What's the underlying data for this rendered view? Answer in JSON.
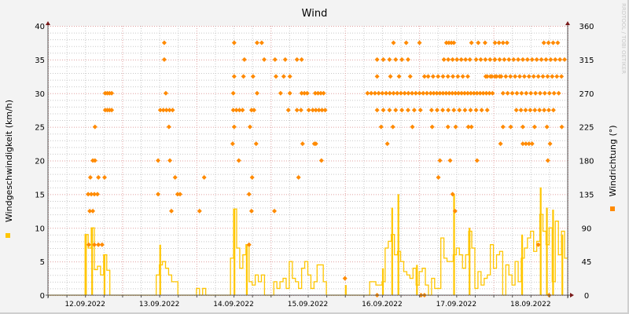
{
  "chart_data": {
    "type": "line",
    "title": "Wind",
    "ylabel": "Windgeschwindigkeit (km/h)",
    "y2label": "Windrichtung (°)",
    "watermark": "RRDTOOL / TOBI OETIKER",
    "ylim": [
      0,
      40
    ],
    "y2lim": [
      0,
      360
    ],
    "yticks": [
      "0",
      "5",
      "10",
      "15",
      "20",
      "25",
      "30",
      "35",
      "40"
    ],
    "y2ticks": [
      "0",
      "45",
      "90",
      "135",
      "180",
      "225",
      "270",
      "315",
      "360"
    ],
    "x_unit": "hours since 12.09.2022 00:00",
    "xlim": [
      0,
      168
    ],
    "xticks": [
      "12.09.2022",
      "13.09.2022",
      "14.09.2022",
      "15.09.2022",
      "16.09.2022",
      "17.09.2022",
      "18.09.2022"
    ],
    "grid": true,
    "colors": {
      "speed": "#ffc600",
      "direction": "#ff8a00",
      "axis": "#7a1a1a",
      "major_grid": "#e0a0a0",
      "minor_grid": "#c8c8c8"
    },
    "speed_hourly": [
      0,
      0,
      0,
      0,
      0,
      0,
      0,
      0,
      0,
      0,
      0,
      0,
      9,
      7,
      10,
      3.8,
      4.3,
      3,
      6,
      3.7,
      0,
      0,
      0,
      0,
      0,
      0,
      0,
      0,
      0,
      0,
      0,
      0,
      0,
      0,
      0,
      3,
      4.5,
      5,
      4,
      3,
      2,
      2,
      0,
      0,
      0,
      0,
      0,
      0,
      1,
      0,
      1,
      0,
      0,
      0,
      0,
      0,
      0,
      0,
      0,
      5.5,
      12.8,
      7,
      4,
      6,
      7.5,
      2,
      1.5,
      3,
      2,
      3,
      0,
      0,
      0,
      2,
      1,
      2,
      2.5,
      1,
      5,
      2.5,
      2,
      1,
      4,
      5,
      3,
      1,
      2,
      4.5,
      4.5,
      2,
      0,
      0,
      0,
      0,
      0,
      0,
      0,
      0,
      0,
      0,
      0,
      0,
      0,
      0,
      2,
      2,
      1.5,
      1.5,
      2,
      7,
      8,
      9,
      6,
      6.5,
      5,
      3.5,
      3,
      2.5,
      4,
      1.5,
      3.5,
      4,
      1.5,
      0,
      2.5,
      1,
      1,
      8.5,
      5.5,
      5,
      5,
      6,
      7,
      6,
      4,
      6,
      9.5,
      7,
      1,
      3.5,
      1.5,
      2.5,
      3,
      7.5,
      4,
      6,
      6.5,
      0,
      4.5,
      3,
      1.5,
      5,
      2,
      5.5,
      7,
      8.5,
      9.5,
      6.5,
      8,
      12,
      9.5,
      7.5,
      10,
      2,
      11,
      6,
      9.5,
      5.5
    ],
    "speed_peaks": [
      [
        12,
        9
      ],
      [
        14,
        10
      ],
      [
        18,
        6
      ],
      [
        36,
        7.5
      ],
      [
        60,
        12.8
      ],
      [
        64,
        7.5
      ],
      [
        96,
        1.5
      ],
      [
        108,
        4
      ],
      [
        111,
        13
      ],
      [
        113,
        15
      ],
      [
        119,
        4.5
      ],
      [
        131,
        15
      ],
      [
        136,
        10
      ],
      [
        153,
        9
      ],
      [
        159,
        16
      ],
      [
        161,
        13
      ],
      [
        163,
        12.7
      ],
      [
        166,
        9
      ]
    ],
    "direction_points": [
      [
        15.2,
        225
      ],
      [
        14.5,
        180
      ],
      [
        15.2,
        180
      ],
      [
        13.7,
        157.5
      ],
      [
        16.3,
        157.5
      ],
      [
        18.3,
        157.5
      ],
      [
        13.5,
        112.5
      ],
      [
        14.5,
        112.5
      ],
      [
        13.2,
        67.5
      ],
      [
        15,
        67.5
      ],
      [
        16.3,
        67.5
      ],
      [
        17.5,
        67.5
      ],
      [
        37.6,
        337.5
      ],
      [
        37.6,
        315
      ],
      [
        38.1,
        270
      ],
      [
        39.1,
        225
      ],
      [
        35.6,
        180
      ],
      [
        39.4,
        180
      ],
      [
        41.1,
        157.5
      ],
      [
        35.6,
        135
      ],
      [
        41.9,
        135
      ],
      [
        42.7,
        135
      ],
      [
        39.9,
        112.5
      ],
      [
        50.5,
        157.5
      ],
      [
        49,
        112.5
      ],
      [
        60.2,
        337.5
      ],
      [
        67.6,
        337.5
      ],
      [
        69.1,
        337.5
      ],
      [
        63.5,
        315
      ],
      [
        69.9,
        315
      ],
      [
        60.2,
        292.5
      ],
      [
        63.2,
        292.5
      ],
      [
        66.3,
        292.5
      ],
      [
        59.9,
        270
      ],
      [
        67.6,
        270
      ],
      [
        60.2,
        225
      ],
      [
        65.3,
        225
      ],
      [
        59.7,
        202.5
      ],
      [
        67.3,
        202.5
      ],
      [
        61.7,
        180
      ],
      [
        66,
        157.5
      ],
      [
        65,
        135
      ],
      [
        65.8,
        112.5
      ],
      [
        65,
        67.5
      ],
      [
        73.2,
        112.5
      ],
      [
        73.4,
        315
      ],
      [
        76.7,
        315
      ],
      [
        80.5,
        315
      ],
      [
        82,
        315
      ],
      [
        73.7,
        292.5
      ],
      [
        76.2,
        292.5
      ],
      [
        78.2,
        292.5
      ],
      [
        75.2,
        270
      ],
      [
        78.2,
        270
      ],
      [
        77.7,
        247.5
      ],
      [
        80.5,
        247.5
      ],
      [
        81.8,
        247.5
      ],
      [
        84.3,
        247.5
      ],
      [
        82.3,
        202.5
      ],
      [
        86.1,
        202.5
      ],
      [
        86.6,
        202.5
      ],
      [
        88.4,
        180
      ],
      [
        81,
        157.5
      ],
      [
        96,
        22.5
      ],
      [
        111.7,
        337.5
      ],
      [
        115.8,
        337.5
      ],
      [
        120.1,
        337.5
      ],
      [
        106.4,
        292.5
      ],
      [
        110.7,
        292.5
      ],
      [
        113.5,
        292.5
      ],
      [
        117.1,
        292.5
      ],
      [
        121.7,
        292.5
      ],
      [
        107.7,
        225
      ],
      [
        111.5,
        225
      ],
      [
        117.8,
        225
      ],
      [
        109.7,
        202.5
      ],
      [
        106.4,
        0
      ],
      [
        120.6,
        0
      ],
      [
        121.7,
        0
      ],
      [
        124.2,
        225
      ],
      [
        129.3,
        225
      ],
      [
        131.8,
        225
      ],
      [
        135.9,
        225
      ],
      [
        136.9,
        225
      ],
      [
        126.7,
        180
      ],
      [
        130,
        180
      ],
      [
        138.7,
        180
      ],
      [
        126.2,
        157.5
      ],
      [
        130.8,
        135
      ],
      [
        131.6,
        112.5
      ],
      [
        147.1,
        225
      ],
      [
        149.6,
        225
      ],
      [
        153.5,
        225
      ],
      [
        157.3,
        225
      ],
      [
        161.3,
        225
      ],
      [
        166.1,
        225
      ],
      [
        146.3,
        202.5
      ],
      [
        162.3,
        202.5
      ],
      [
        161.6,
        180
      ],
      [
        158.5,
        67.5
      ],
      [
        162,
        0
      ]
    ],
    "direction_runs": [
      [
        13,
        16.5,
        1,
        135
      ],
      [
        18.5,
        20.6,
        0.7,
        270
      ],
      [
        18.5,
        20.6,
        0.7,
        247.5
      ],
      [
        36.3,
        40.4,
        1,
        247.5
      ],
      [
        59.9,
        63,
        1,
        247.5
      ],
      [
        65.8,
        67.3,
        0.8,
        247.5
      ],
      [
        82,
        84.6,
        0.9,
        270
      ],
      [
        86.4,
        89.7,
        0.9,
        270
      ],
      [
        85.6,
        89.9,
        1,
        247.5
      ],
      [
        103.3,
        122.9,
        1.2,
        270
      ],
      [
        106.4,
        117.8,
        2,
        315
      ],
      [
        106.4,
        121.7,
        2,
        247.5
      ],
      [
        128.8,
        131.3,
        0.8,
        337.5
      ],
      [
        136.9,
        143.3,
        2.2,
        337.5
      ],
      [
        128,
        136.4,
        1.4,
        315
      ],
      [
        138.4,
        144.5,
        1.5,
        315
      ],
      [
        122.9,
        136.9,
        1.6,
        292.5
      ],
      [
        141.5,
        147.1,
        1.5,
        292.5
      ],
      [
        123.7,
        144.5,
        1,
        270
      ],
      [
        124,
        142,
        1.8,
        247.5
      ],
      [
        144.5,
        149.6,
        1.3,
        337.5
      ],
      [
        160.3,
        166.1,
        1.5,
        337.5
      ],
      [
        144.5,
        167.4,
        1.5,
        315
      ],
      [
        142,
        166.1,
        1.5,
        292.5
      ],
      [
        147.1,
        166.1,
        1.5,
        270
      ],
      [
        151.4,
        164.8,
        1.5,
        247.5
      ],
      [
        153.5,
        157.3,
        1,
        202.5
      ]
    ]
  }
}
